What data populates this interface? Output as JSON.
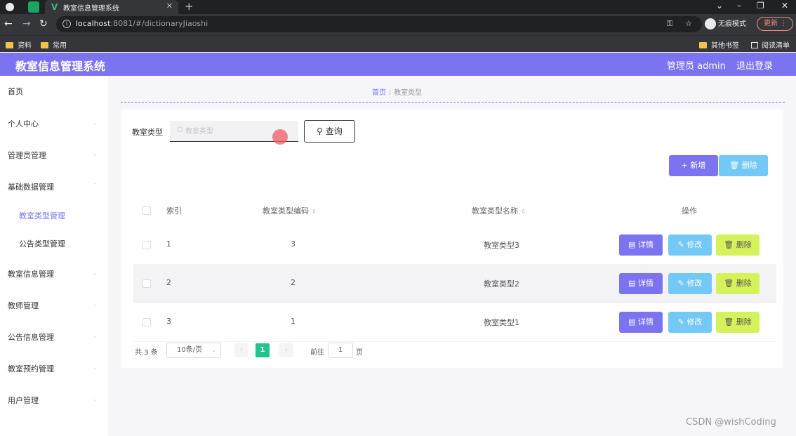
{
  "browser": {
    "tab_title": "教室信息管理系统",
    "url_host": "localhost",
    "url_rest": ":8081/#/dictionaryJiaoshi",
    "incognito_label": "无痕模式",
    "update_label": "更新",
    "bookmarks": [
      "资料",
      "常用"
    ],
    "bookmarks_right": [
      "其他书签",
      "阅读清单"
    ]
  },
  "app": {
    "title": "教室信息管理系统",
    "admin_label": "管理员 admin",
    "logout_label": "退出登录"
  },
  "sidebar": {
    "items": [
      "首页",
      "个人中心",
      "管理员管理",
      "基础数据管理"
    ],
    "sub_items": [
      "教室类型管理",
      "公告类型管理"
    ],
    "items_after": [
      "教室信息管理",
      "教师管理",
      "公告信息管理",
      "教室预约管理",
      "用户管理"
    ]
  },
  "breadcrumb": {
    "home": "首页",
    "current": "教室类型"
  },
  "search": {
    "label": "教室类型",
    "placeholder": "教室类型",
    "button": "查询"
  },
  "actions": {
    "add": "新增",
    "delete": "删除"
  },
  "table": {
    "headers": [
      "索引",
      "教室类型编码",
      "教室类型名称",
      "操作"
    ],
    "rows": [
      {
        "index": "1",
        "code": "3",
        "name": "教室类型3"
      },
      {
        "index": "2",
        "code": "2",
        "name": "教室类型2"
      },
      {
        "index": "3",
        "code": "1",
        "name": "教室类型1"
      }
    ],
    "op_labels": {
      "detail": "详情",
      "edit": "修改",
      "delete": "删除"
    }
  },
  "pagination": {
    "total": "共 3 条",
    "page_size": "10条/页",
    "current_page": "1",
    "goto_label": "前往",
    "goto_value": "1",
    "page_suffix": "页"
  },
  "watermark": "CSDN @wishCoding",
  "colors": {
    "primary": "#7b73f0",
    "info": "#74c8f5",
    "warning": "#d4f35a",
    "page_active": "#22c58f"
  }
}
